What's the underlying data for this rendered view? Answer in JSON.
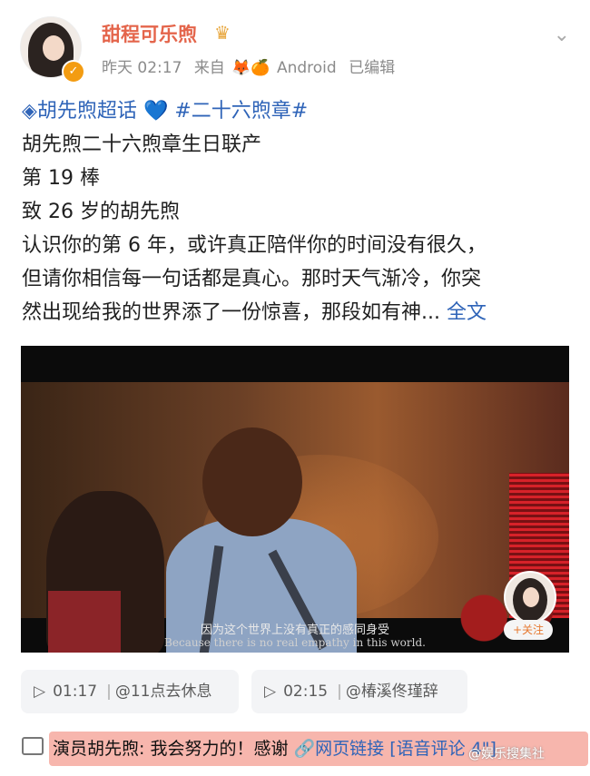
{
  "header": {
    "username": "甜程可乐煦",
    "time": "昨天 02:17",
    "source_prefix": "来自",
    "source_icons": "🦊🍊",
    "source_name": "Android",
    "edited": "已编辑",
    "crown_icon": "crown-icon",
    "verified_icon": "verified-icon"
  },
  "post": {
    "topic_super": "胡先煦超话",
    "topic_tag": "#二十六煦章#",
    "line1": "胡先煦二十六煦章生日联产",
    "line2": "第 19 棒",
    "line3": "致 26 岁的胡先煦",
    "line4": "认识你的第 6 年，或许真正陪伴你的时间没有很久，",
    "line5": "但请你相信每一句话都是真心。那时天气渐冷，你突",
    "line6": "然出现给我的世界添了一份惊喜，那段如有神...",
    "more_label": "全文"
  },
  "video": {
    "subtitle_cn": "因为这个世界上没有真正的感同身受",
    "subtitle_en": "Because there is no real empathy in this world.",
    "follow_label": "+关注"
  },
  "chips": [
    {
      "time": "01:17",
      "label": "@11点去休息"
    },
    {
      "time": "02:15",
      "label": "@椿溪佟瑾辞"
    }
  ],
  "comment": {
    "text": "演员胡先煦: 我会努力的！感谢",
    "link": "网页链接",
    "voice": "[语音评论 4\"]"
  },
  "watermark": "@娱乐搜集社"
}
